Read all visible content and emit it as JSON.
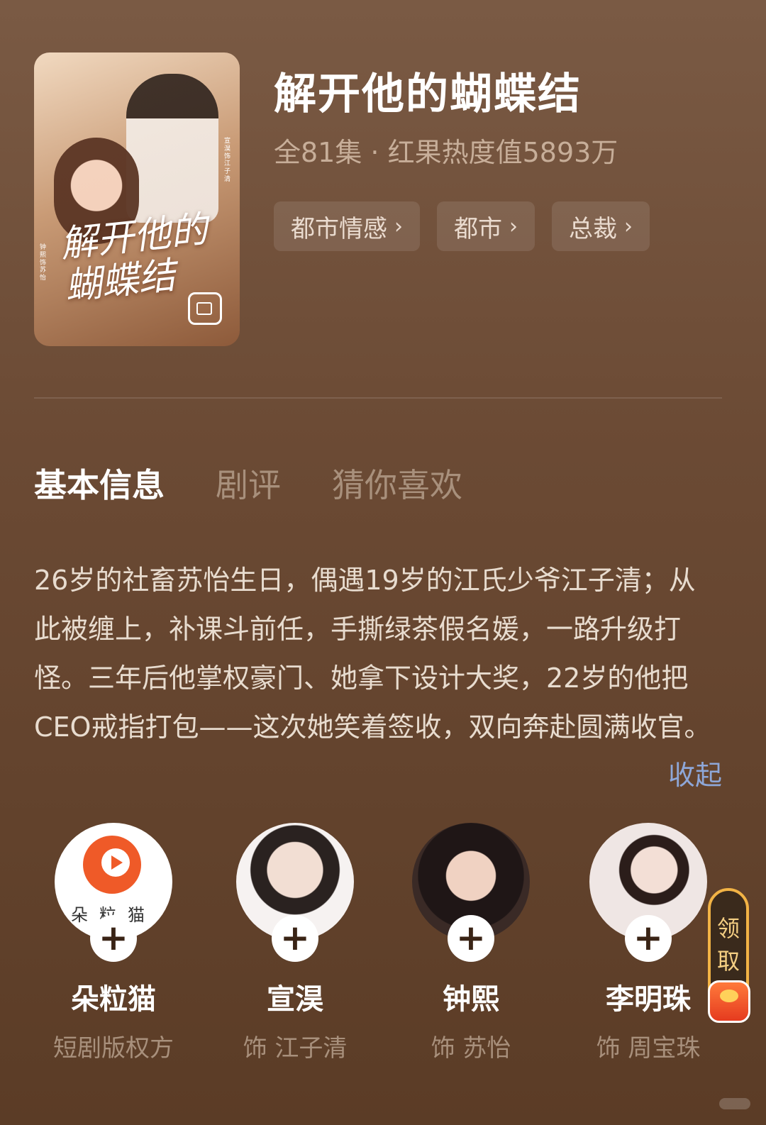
{
  "poster": {
    "title_art": "解开他的蝴蝶结",
    "cast_m": "宣淏 饰 江子清",
    "cast_f": "钟熙 饰 苏怡"
  },
  "show": {
    "title": "解开他的蝴蝶结",
    "meta": "全81集 · 红果热度值5893万",
    "tags": [
      "都市情感",
      "都市",
      "总裁"
    ]
  },
  "tabs": [
    "基本信息",
    "剧评",
    "猜你喜欢"
  ],
  "synopsis": "26岁的社畜苏怡生日，偶遇19岁的江氏少爷江子清；从此被缠上，补课斗前任，手撕绿茶假名媛，一路升级打怪。三年后他掌权豪门、她拿下设计大奖，22岁的他把CEO戒指打包——这次她笑着签收，双向奔赴圆满收官。",
  "collapse_label": "收起",
  "people": [
    {
      "name": "朵粒猫",
      "role": "短剧版权方",
      "logo_text": "朵粒猫"
    },
    {
      "name": "宣淏",
      "role": "饰 江子清"
    },
    {
      "name": "钟熙",
      "role": "饰 苏怡"
    },
    {
      "name": "李明珠",
      "role": "饰 周宝珠"
    }
  ],
  "claim": {
    "line1": "领",
    "line2": "取"
  },
  "colors": {
    "accent_link": "#8ea7d8",
    "claim_border": "#f2b345"
  }
}
